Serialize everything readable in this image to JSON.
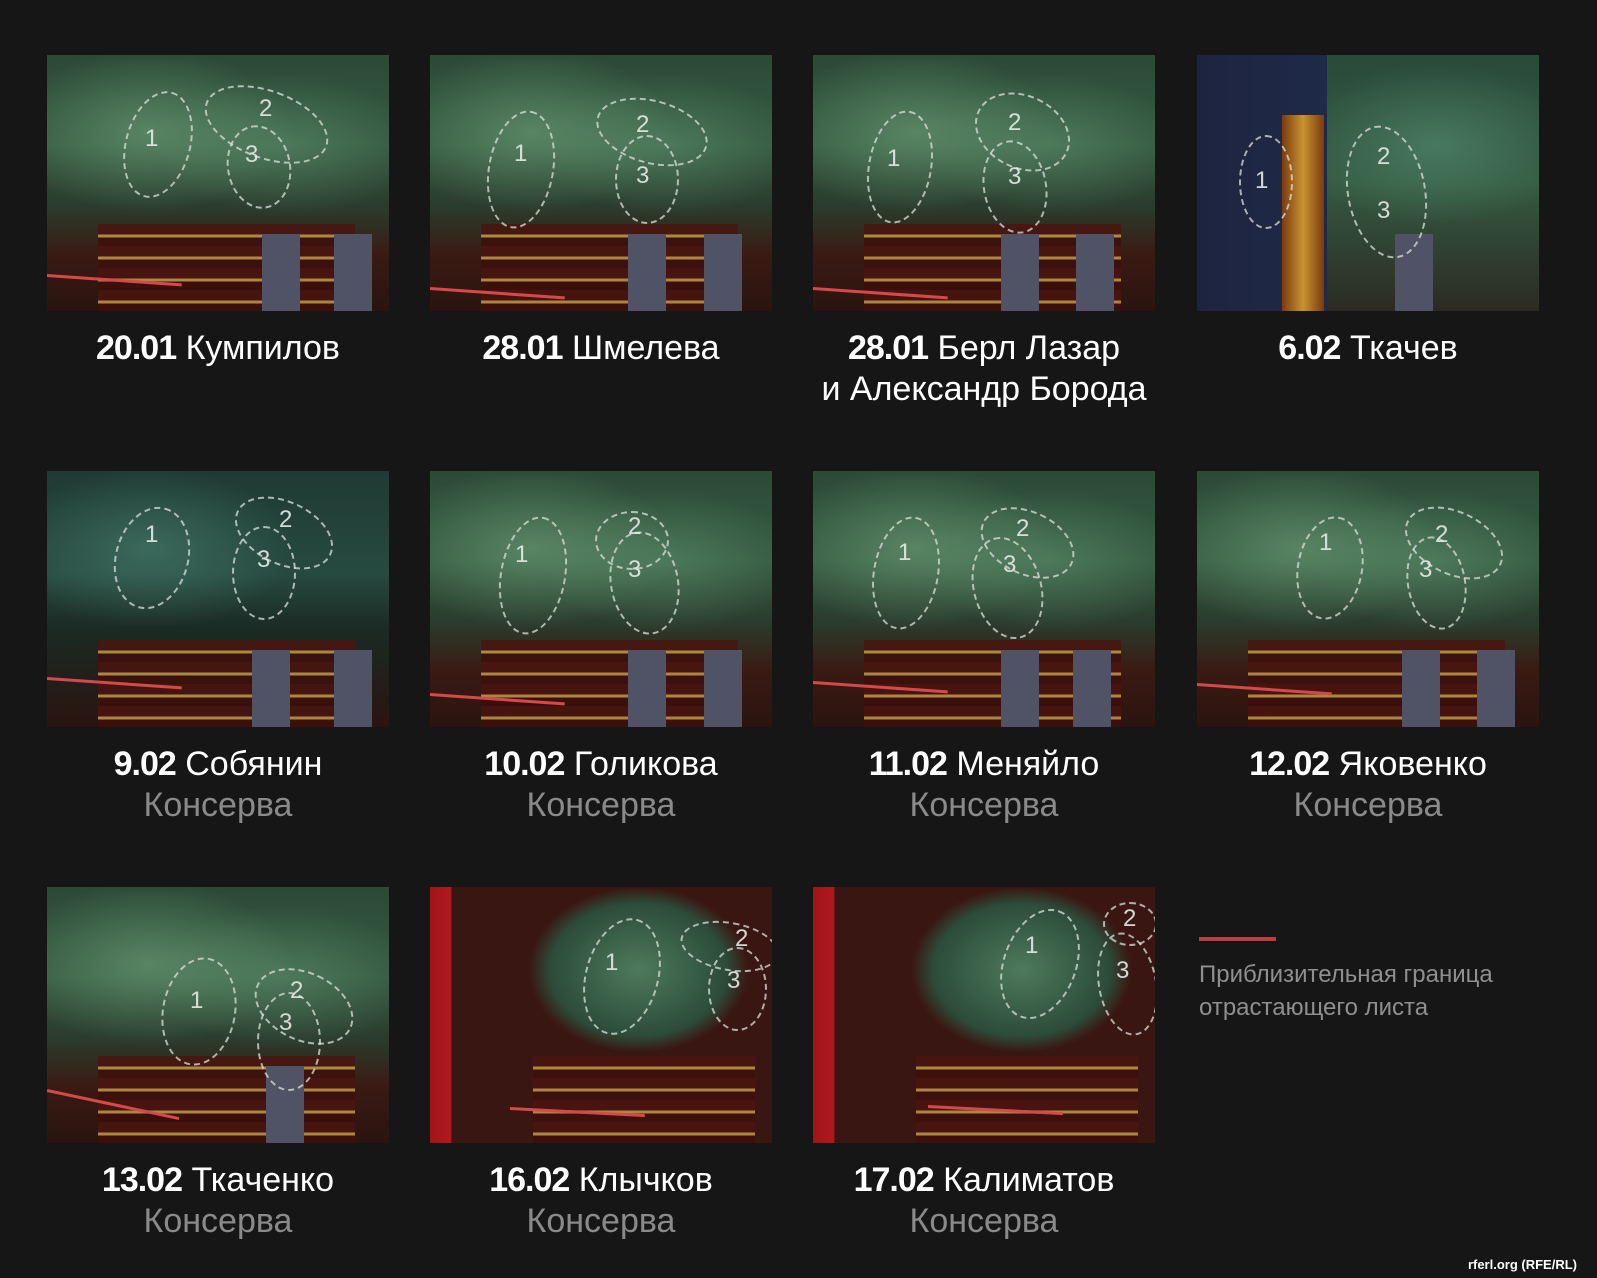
{
  "cells": [
    {
      "date": "20.01",
      "name": "Кумпилов",
      "sub": ""
    },
    {
      "date": "28.01",
      "name": "Шмелева",
      "sub": ""
    },
    {
      "date": "28.01",
      "name": "Берл Лазар",
      "line2": "и Александр Борода",
      "sub": ""
    },
    {
      "date": "6.02",
      "name": "Ткачев",
      "sub": ""
    },
    {
      "date": "9.02",
      "name": "Собянин",
      "sub": "Консерва"
    },
    {
      "date": "10.02",
      "name": "Голикова",
      "sub": "Консерва"
    },
    {
      "date": "11.02",
      "name": "Меняйло",
      "sub": "Консерва"
    },
    {
      "date": "12.02",
      "name": "Яковенко",
      "sub": "Консерва"
    },
    {
      "date": "13.02",
      "name": "Ткаченко",
      "sub": "Консерва"
    },
    {
      "date": "16.02",
      "name": "Клычков",
      "sub": "Консерва"
    },
    {
      "date": "17.02",
      "name": "Калиматов",
      "sub": "Консерва"
    }
  ],
  "leaf_labels": [
    "1",
    "2",
    "3"
  ],
  "legend": {
    "text": "Приблизительная граница отрастающего листа",
    "color": "#c03d3f"
  },
  "credit": "rferl.org (RFE/RL)"
}
